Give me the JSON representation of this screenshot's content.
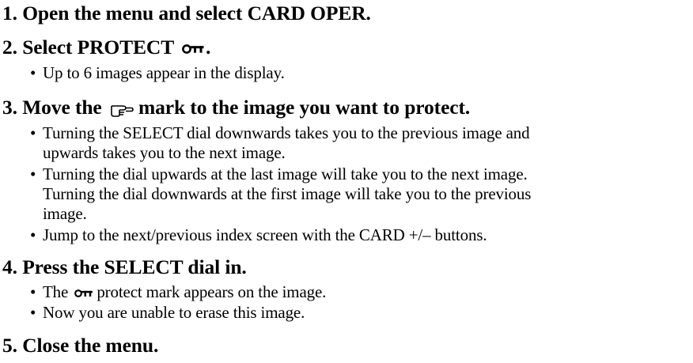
{
  "steps": [
    {
      "heading": "1. Open the menu and select CARD OPER."
    },
    {
      "heading_pre": "2. Select PROTECT",
      "heading_post": ".",
      "bullets": [
        "Up to 6 images appear in the display."
      ]
    },
    {
      "heading_pre": "3. Move the",
      "heading_post": "mark to the image you want to protect.",
      "bullets": [
        "Turning the SELECT dial downwards takes you to the previous image and",
        "upwards takes you to the next image.",
        "Turning the dial upwards at the last image will take you to the next image.",
        "Turning the dial downwards at the first image will take you to the previous",
        "image.",
        "Jump to the next/previous index screen with the CARD +/– buttons."
      ]
    },
    {
      "heading": "4. Press the SELECT dial in.",
      "bullets": [
        {
          "pre": "The",
          "post": "protect mark appears on the image."
        },
        "Now you are unable to erase this image."
      ]
    },
    {
      "heading": "5. Close the menu."
    }
  ],
  "bullet_char": "•",
  "icons": {
    "protect": "key-icon",
    "pointer": "pointing-hand-icon"
  }
}
